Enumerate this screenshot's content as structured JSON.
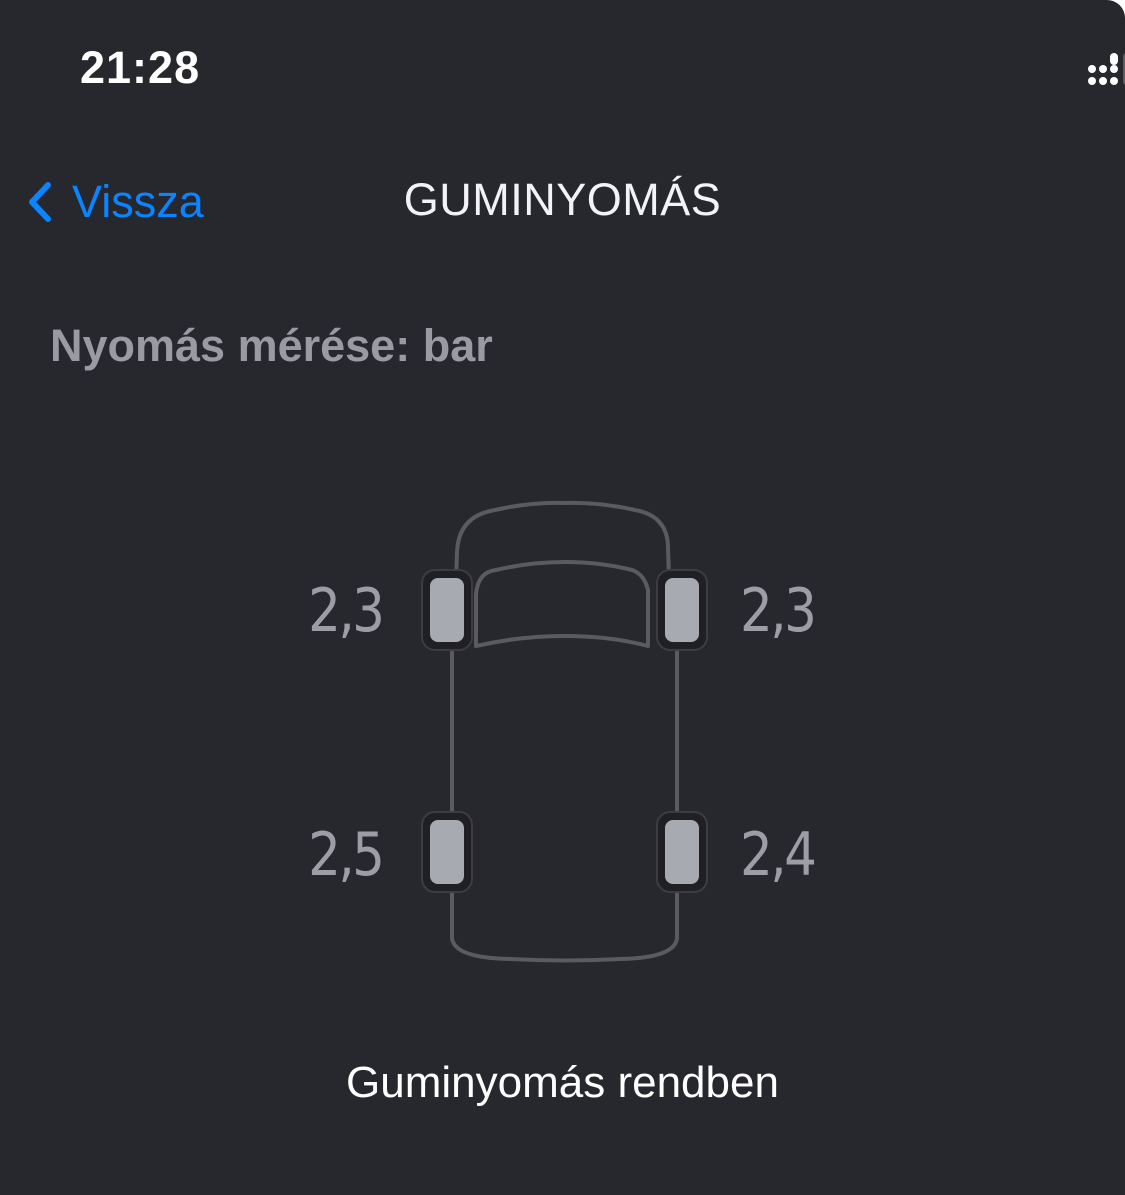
{
  "status_bar": {
    "time": "21:28",
    "battery": "100",
    "icons": [
      "signal-icon",
      "wifi-icon",
      "battery-icon"
    ],
    "battery_color": "#34c759"
  },
  "nav": {
    "back_label": "Vissza",
    "title": "GUMINYOMÁS",
    "accent_color": "#0a84ff"
  },
  "units_label": "Nyomás mérése: bar",
  "tires": {
    "front_left": "2,3",
    "front_right": "2,3",
    "rear_left": "2,5",
    "rear_right": "2,4"
  },
  "status_message": "Guminyomás rendben",
  "colors": {
    "background": "#27272e",
    "car_outline": "#5a5a60",
    "tire_fill": "#a8aab2",
    "value_text": "#9d9da5"
  }
}
